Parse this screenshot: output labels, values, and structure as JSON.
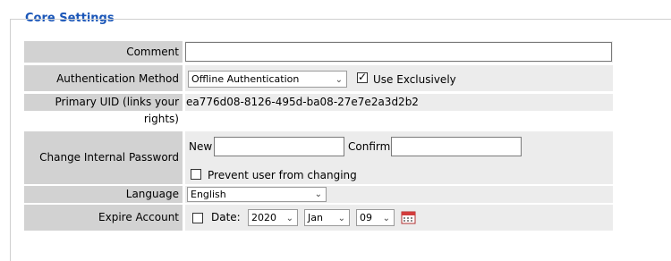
{
  "section": {
    "title": "Core Settings"
  },
  "comment": {
    "label": "Comment",
    "value": ""
  },
  "auth": {
    "label": "Authentication Method",
    "selected": "Offline Authentication",
    "use_exclusively_label": "Use Exclusively",
    "use_exclusively_checked": true
  },
  "uid": {
    "label": "Primary UID (links your rights)",
    "value": "ea776d08-8126-495d-ba08-27e7e2a3d2b2"
  },
  "password": {
    "label": "Change Internal Password",
    "new_label": "New",
    "new_value": "",
    "confirm_label": "Confirm",
    "confirm_value": "",
    "prevent_label": "Prevent user from changing",
    "prevent_checked": false
  },
  "language": {
    "label": "Language",
    "selected": "English"
  },
  "expire": {
    "label": "Expire Account",
    "date_label": "Date:",
    "enabled": false,
    "year": "2020",
    "month": "Jan",
    "day": "09"
  },
  "icons": {
    "chevron": "chevron-down-icon",
    "calendar": "calendar-icon",
    "check": "checkmark-icon"
  }
}
